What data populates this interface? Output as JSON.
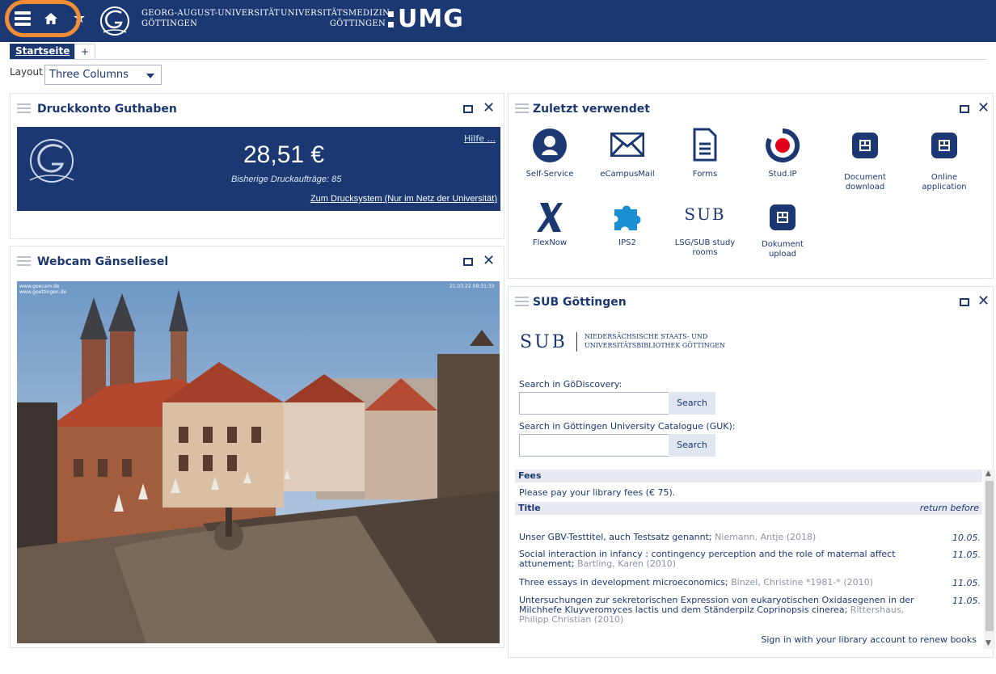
{
  "header": {
    "university_line1": "GEORG-AUGUST-UNIVERSITÄT",
    "university_line2": "GÖTTINGEN",
    "med_line1": "UNIVERSITÄTSMEDIZIN",
    "med_line2": "GÖTTINGEN",
    "umg": "UMG",
    "icons": [
      "menu-icon",
      "home-icon",
      "star-icon"
    ]
  },
  "tabs": {
    "active": "Startseite",
    "add": "+"
  },
  "layout": {
    "label": "Layout",
    "value": "Three Columns"
  },
  "druckkonto": {
    "title": "Druckkonto Guthaben",
    "help": "Hilfe ...",
    "amount": "28,51 €",
    "subtitle": "Bisherige Druckaufträge: 85",
    "link": "Zum Drucksystem (Nur im Netz der Universität)"
  },
  "webcam": {
    "title": "Webcam Gänseliesel",
    "overlay_left1": "www.goecam.de",
    "overlay_left2": "www.goettingen.de",
    "overlay_right": "21.03.22 09:31:33"
  },
  "recent": {
    "title": "Zuletzt verwendet",
    "apps": [
      {
        "label": "Self-Service",
        "icon": "person-icon"
      },
      {
        "label": "eCampusMail",
        "icon": "mail-icon"
      },
      {
        "label": "Forms",
        "icon": "document-icon"
      },
      {
        "label": "Stud.IP",
        "icon": "studip-icon"
      },
      {
        "label": "Document download",
        "icon": "app-tile-icon"
      },
      {
        "label": "Online application",
        "icon": "app-tile-icon"
      },
      {
        "label": "FlexNow",
        "icon": "flexnow-x-icon"
      },
      {
        "label": "IPS2",
        "icon": "puzzle-icon"
      },
      {
        "label": "LSG/SUB study rooms",
        "icon": "sub-logo-icon"
      },
      {
        "label": "Dokument upload",
        "icon": "app-tile-icon"
      }
    ]
  },
  "sub": {
    "title": "SUB Göttingen",
    "logo_mark": "SUB",
    "logo_line1": "NIEDERSÄCHSISCHE STAATS- UND",
    "logo_line2": "UNIVERSITÄTSBIBLIOTHEK GÖTTINGEN",
    "search1_label": "Search in GöDiscovery:",
    "search2_label": "Search in Göttingen University Catalogue (GUK):",
    "search_button": "Search",
    "fees_header": "Fees",
    "fees_note": "Please pay your library fees (€ 75).",
    "loans_header": "Title",
    "loans_return": "return before",
    "loans": [
      {
        "title": "Unser GBV-Testtitel, auch Testsatz genannt;",
        "meta": "Niemann, Antje (2018)",
        "date": "10.05."
      },
      {
        "title": "Social interaction in infancy : contingency perception and the role of maternal affect attunement;",
        "meta": "Bartling, Karen (2010)",
        "date": "11.05."
      },
      {
        "title": "Three essays in development microeconomics;",
        "meta": "Binzel, Christine *1981-* (2010)",
        "date": "11.05."
      },
      {
        "title": "Untersuchungen zur sekretorischen Expression von eukaryotischen Oxidasegenen in der Milchhefe Kluyveromyces lactis und dem Ständerpilz Coprinopsis cinerea;",
        "meta": "Rittershaus, Philipp Christian (2010)",
        "date": "11.05."
      }
    ],
    "renew": "Sign in with your library account to renew books"
  }
}
